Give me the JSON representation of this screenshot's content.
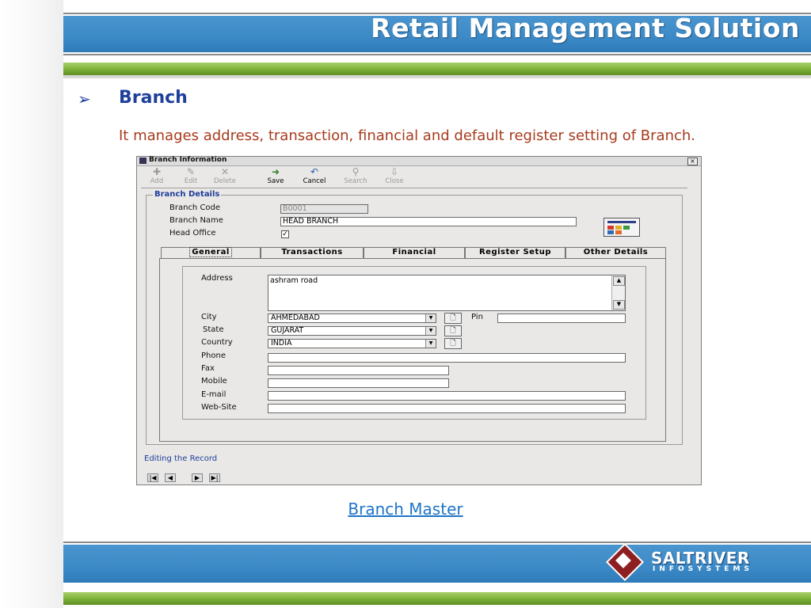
{
  "slide": {
    "header_title": "Retail Management Solution",
    "bullet_glyph": "➢",
    "heading": "Branch",
    "description": "It manages address, transaction, financial and default register setting of Branch.",
    "caption": "Branch Master",
    "logo_main": "SALTRIVER",
    "logo_sub": "INFOSYSTEMS"
  },
  "window": {
    "title": "Branch Information",
    "close_glyph": "×",
    "toolbar": [
      {
        "name": "add",
        "label": "Add",
        "glyph": "✚",
        "state": "disabled"
      },
      {
        "name": "edit",
        "label": "Edit",
        "glyph": "✎",
        "state": "disabled"
      },
      {
        "name": "delete",
        "label": "Delete",
        "glyph": "✕",
        "state": "disabled"
      },
      {
        "name": "save",
        "label": "Save",
        "glyph": "➜",
        "state": "active"
      },
      {
        "name": "cancel",
        "label": "Cancel",
        "glyph": "↶",
        "state": "active"
      },
      {
        "name": "search",
        "label": "Search",
        "glyph": "⚲",
        "state": "disabled"
      },
      {
        "name": "close",
        "label": "Close",
        "glyph": "⇩",
        "state": "disabled"
      }
    ],
    "group_title": "Branch Details",
    "branch_code_label": "Branch Code",
    "branch_code_value": "B0001",
    "branch_name_label": "Branch Name",
    "branch_name_value": "HEAD BRANCH",
    "head_office_label": "Head Office",
    "head_office_check": "✓",
    "tabs": [
      {
        "label": "General"
      },
      {
        "label": "Transactions"
      },
      {
        "label": "Financial"
      },
      {
        "label": "Register Setup"
      },
      {
        "label": "Other Details"
      }
    ],
    "general": {
      "address_label": "Address",
      "address_value": "ashram road",
      "city_label": "City",
      "city_value": "AHMEDABAD",
      "pin_label": "Pin",
      "pin_value": "",
      "state_label": "State",
      "state_value": "GUJARAT",
      "country_label": "Country",
      "country_value": "INDIA",
      "phone_label": "Phone",
      "fax_label": "Fax",
      "mobile_label": "Mobile",
      "email_label": "E-mail",
      "website_label": "Web-Site",
      "dropdown_glyph": "▼",
      "doc_glyph": "🗋",
      "scroll_up": "▲",
      "scroll_down": "▼"
    },
    "status": "Editing the Record",
    "nav": {
      "first": "|◀",
      "prev": "◀",
      "next": "▶",
      "last": "▶|"
    }
  }
}
